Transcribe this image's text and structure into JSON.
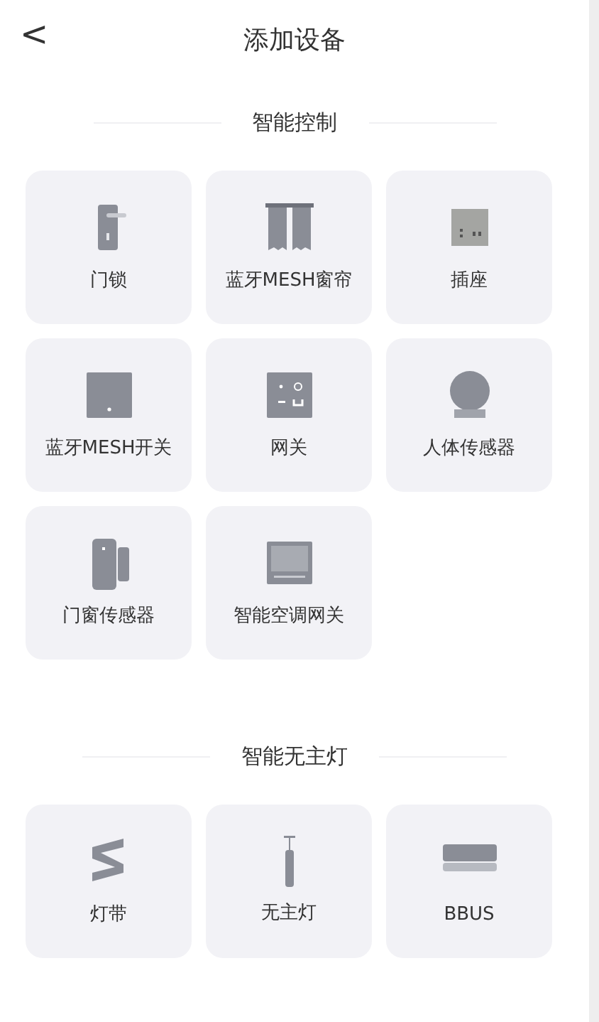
{
  "header": {
    "back": "<",
    "title": "添加设备"
  },
  "sections": [
    {
      "title": "智能控制",
      "devices": [
        {
          "kind": "lock",
          "label": "门锁"
        },
        {
          "kind": "curtain",
          "label": "蓝牙MESH窗帘"
        },
        {
          "kind": "socket",
          "label": "插座"
        },
        {
          "kind": "switch",
          "label": "蓝牙MESH开关"
        },
        {
          "kind": "gateway",
          "label": "网关"
        },
        {
          "kind": "sensor",
          "label": "人体传感器"
        },
        {
          "kind": "doorsensor",
          "label": "门窗传感器"
        },
        {
          "kind": "panel",
          "label": "智能空调网关"
        }
      ]
    },
    {
      "title": "智能无主灯",
      "devices": [
        {
          "kind": "strip",
          "label": "灯带"
        },
        {
          "kind": "spot",
          "label": "无主灯"
        },
        {
          "kind": "bar",
          "label": "BBUS"
        }
      ]
    }
  ]
}
